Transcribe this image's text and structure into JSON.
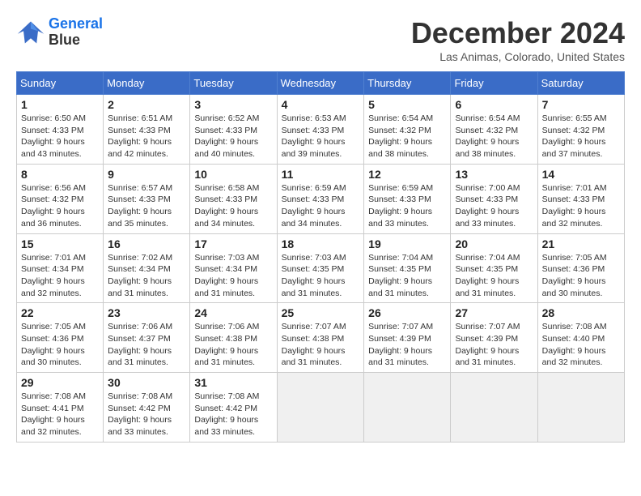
{
  "header": {
    "logo_line1": "General",
    "logo_line2": "Blue",
    "month_year": "December 2024",
    "location": "Las Animas, Colorado, United States"
  },
  "weekdays": [
    "Sunday",
    "Monday",
    "Tuesday",
    "Wednesday",
    "Thursday",
    "Friday",
    "Saturday"
  ],
  "weeks": [
    [
      {
        "day": 1,
        "sunrise": "6:50 AM",
        "sunset": "4:33 PM",
        "daylight": "9 hours and 43 minutes."
      },
      {
        "day": 2,
        "sunrise": "6:51 AM",
        "sunset": "4:33 PM",
        "daylight": "9 hours and 42 minutes."
      },
      {
        "day": 3,
        "sunrise": "6:52 AM",
        "sunset": "4:33 PM",
        "daylight": "9 hours and 40 minutes."
      },
      {
        "day": 4,
        "sunrise": "6:53 AM",
        "sunset": "4:33 PM",
        "daylight": "9 hours and 39 minutes."
      },
      {
        "day": 5,
        "sunrise": "6:54 AM",
        "sunset": "4:32 PM",
        "daylight": "9 hours and 38 minutes."
      },
      {
        "day": 6,
        "sunrise": "6:54 AM",
        "sunset": "4:32 PM",
        "daylight": "9 hours and 38 minutes."
      },
      {
        "day": 7,
        "sunrise": "6:55 AM",
        "sunset": "4:32 PM",
        "daylight": "9 hours and 37 minutes."
      }
    ],
    [
      {
        "day": 8,
        "sunrise": "6:56 AM",
        "sunset": "4:32 PM",
        "daylight": "9 hours and 36 minutes."
      },
      {
        "day": 9,
        "sunrise": "6:57 AM",
        "sunset": "4:33 PM",
        "daylight": "9 hours and 35 minutes."
      },
      {
        "day": 10,
        "sunrise": "6:58 AM",
        "sunset": "4:33 PM",
        "daylight": "9 hours and 34 minutes."
      },
      {
        "day": 11,
        "sunrise": "6:59 AM",
        "sunset": "4:33 PM",
        "daylight": "9 hours and 34 minutes."
      },
      {
        "day": 12,
        "sunrise": "6:59 AM",
        "sunset": "4:33 PM",
        "daylight": "9 hours and 33 minutes."
      },
      {
        "day": 13,
        "sunrise": "7:00 AM",
        "sunset": "4:33 PM",
        "daylight": "9 hours and 33 minutes."
      },
      {
        "day": 14,
        "sunrise": "7:01 AM",
        "sunset": "4:33 PM",
        "daylight": "9 hours and 32 minutes."
      }
    ],
    [
      {
        "day": 15,
        "sunrise": "7:01 AM",
        "sunset": "4:34 PM",
        "daylight": "9 hours and 32 minutes."
      },
      {
        "day": 16,
        "sunrise": "7:02 AM",
        "sunset": "4:34 PM",
        "daylight": "9 hours and 31 minutes."
      },
      {
        "day": 17,
        "sunrise": "7:03 AM",
        "sunset": "4:34 PM",
        "daylight": "9 hours and 31 minutes."
      },
      {
        "day": 18,
        "sunrise": "7:03 AM",
        "sunset": "4:35 PM",
        "daylight": "9 hours and 31 minutes."
      },
      {
        "day": 19,
        "sunrise": "7:04 AM",
        "sunset": "4:35 PM",
        "daylight": "9 hours and 31 minutes."
      },
      {
        "day": 20,
        "sunrise": "7:04 AM",
        "sunset": "4:35 PM",
        "daylight": "9 hours and 31 minutes."
      },
      {
        "day": 21,
        "sunrise": "7:05 AM",
        "sunset": "4:36 PM",
        "daylight": "9 hours and 30 minutes."
      }
    ],
    [
      {
        "day": 22,
        "sunrise": "7:05 AM",
        "sunset": "4:36 PM",
        "daylight": "9 hours and 30 minutes."
      },
      {
        "day": 23,
        "sunrise": "7:06 AM",
        "sunset": "4:37 PM",
        "daylight": "9 hours and 31 minutes."
      },
      {
        "day": 24,
        "sunrise": "7:06 AM",
        "sunset": "4:38 PM",
        "daylight": "9 hours and 31 minutes."
      },
      {
        "day": 25,
        "sunrise": "7:07 AM",
        "sunset": "4:38 PM",
        "daylight": "9 hours and 31 minutes."
      },
      {
        "day": 26,
        "sunrise": "7:07 AM",
        "sunset": "4:39 PM",
        "daylight": "9 hours and 31 minutes."
      },
      {
        "day": 27,
        "sunrise": "7:07 AM",
        "sunset": "4:39 PM",
        "daylight": "9 hours and 31 minutes."
      },
      {
        "day": 28,
        "sunrise": "7:08 AM",
        "sunset": "4:40 PM",
        "daylight": "9 hours and 32 minutes."
      }
    ],
    [
      {
        "day": 29,
        "sunrise": "7:08 AM",
        "sunset": "4:41 PM",
        "daylight": "9 hours and 32 minutes."
      },
      {
        "day": 30,
        "sunrise": "7:08 AM",
        "sunset": "4:42 PM",
        "daylight": "9 hours and 33 minutes."
      },
      {
        "day": 31,
        "sunrise": "7:08 AM",
        "sunset": "4:42 PM",
        "daylight": "9 hours and 33 minutes."
      },
      null,
      null,
      null,
      null
    ]
  ]
}
